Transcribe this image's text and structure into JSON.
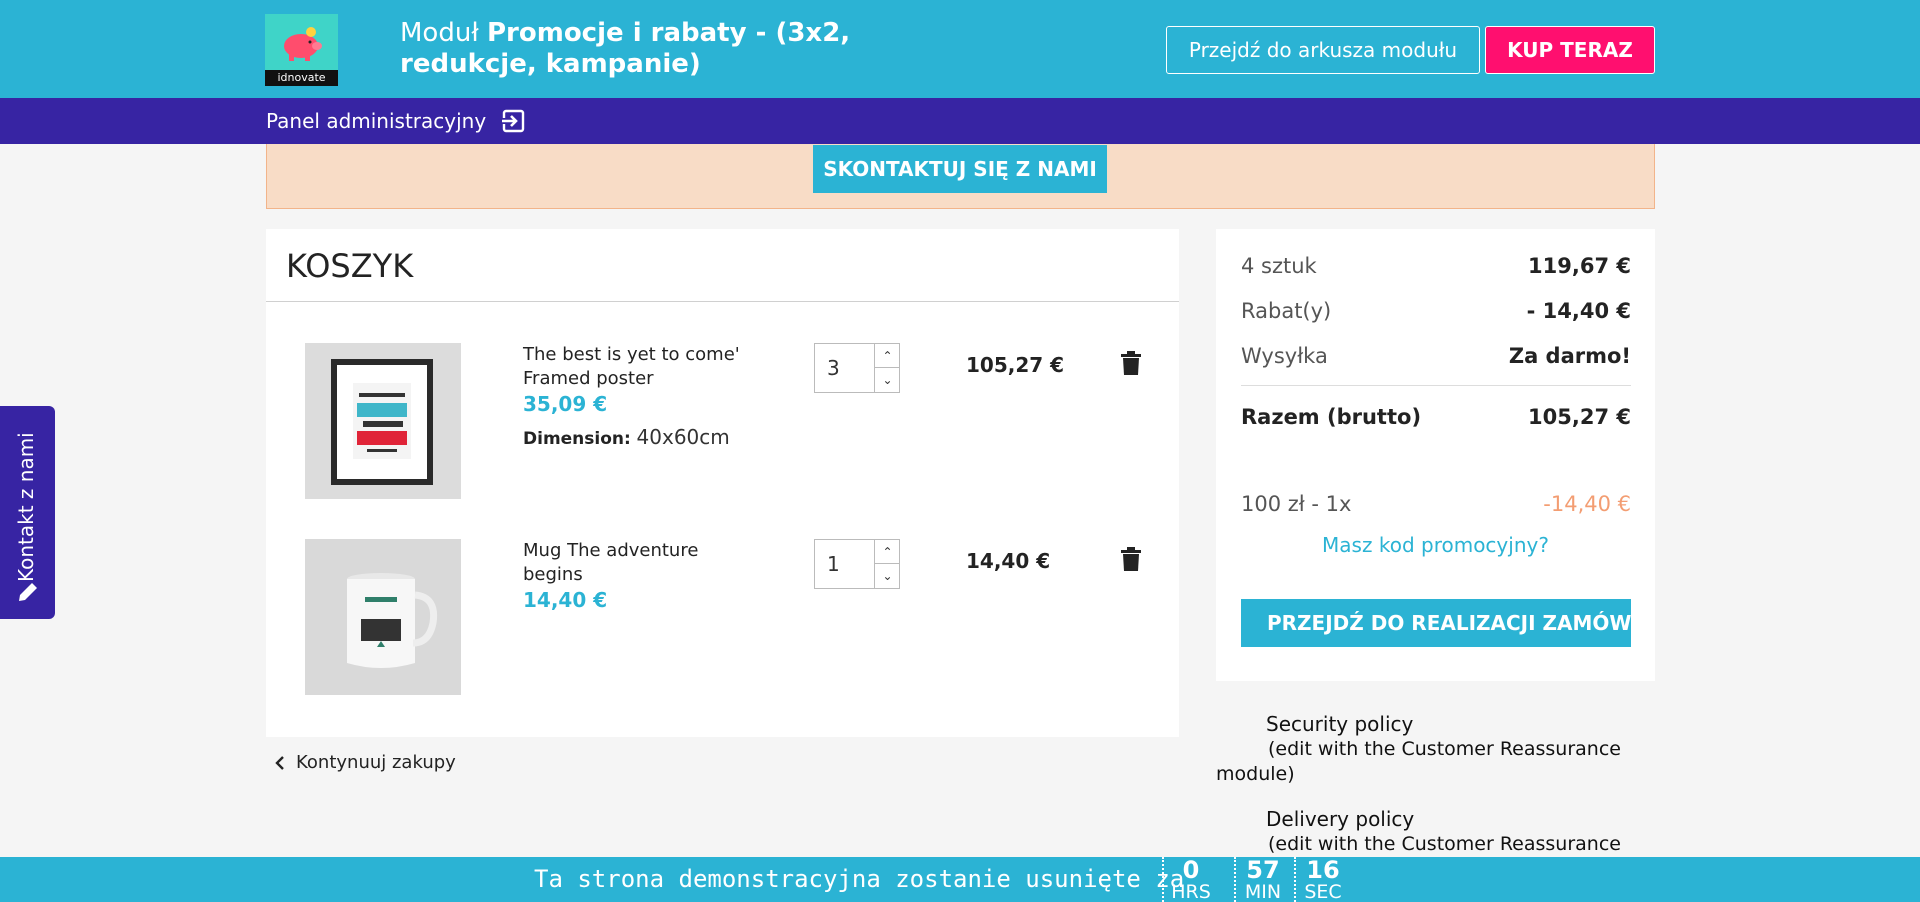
{
  "header": {
    "logo_text": "idnovate",
    "title_prefix": "Moduł ",
    "title_bold": "Promocje i rabaty - (3x2, redukcje, kampanie)",
    "sheet_button": "Przejdź do arkusza modułu",
    "buy_button": "KUP TERAZ",
    "admin_link": "Panel administracyjny"
  },
  "banner": {
    "contact_button": "SKONTAKTUJ SIĘ Z NAMI"
  },
  "cart": {
    "title": "KOSZYK",
    "items": [
      {
        "name": "The best is yet to come' Framed poster",
        "price": "35,09 €",
        "attr_label": "Dimension:",
        "attr_value": "40x60cm",
        "qty": "3",
        "total": "105,27 €",
        "image": "framed-poster"
      },
      {
        "name": "Mug The adventure begins",
        "price": "14,40 €",
        "qty": "1",
        "total": "14,40 €",
        "image": "mug"
      }
    ],
    "continue": "Kontynuuj zakupy"
  },
  "summary": {
    "items_label": "4 sztuk",
    "items_value": "119,67 €",
    "discount_label": "Rabat(y)",
    "discount_value": "- 14,40 €",
    "shipping_label": "Wysyłka",
    "shipping_value": "Za darmo!",
    "total_label": "Razem (brutto)",
    "total_value": "105,27 €",
    "voucher_label": "100 zł - 1x",
    "voucher_value": "-14,40 €",
    "promo_link": "Masz kod promocyjny?",
    "checkout_button": "PRZEJDŹ DO REALIZACJI ZAMÓWIENIA"
  },
  "reassurance": [
    {
      "title": "Security policy",
      "sub1": "(edit with the Customer Reassurance",
      "sub2": "module)"
    },
    {
      "title": "Delivery policy",
      "sub1": "(edit with the Customer Reassurance",
      "sub2": ""
    }
  ],
  "side_contact": "Kontakt z nami",
  "demo_bar": {
    "text": "Ta strona demonstracyjna zostanie usunięte za",
    "hours": "0",
    "hours_label": "HRS",
    "minutes": "57",
    "minutes_label": "MIN",
    "seconds": "16",
    "seconds_label": "SEC"
  },
  "colors": {
    "primary": "#2bb3d4",
    "admin_bar": "#3724a3",
    "buy": "#ff0f6f",
    "banner": "#f8dcc6",
    "discount": "#f39d72"
  }
}
